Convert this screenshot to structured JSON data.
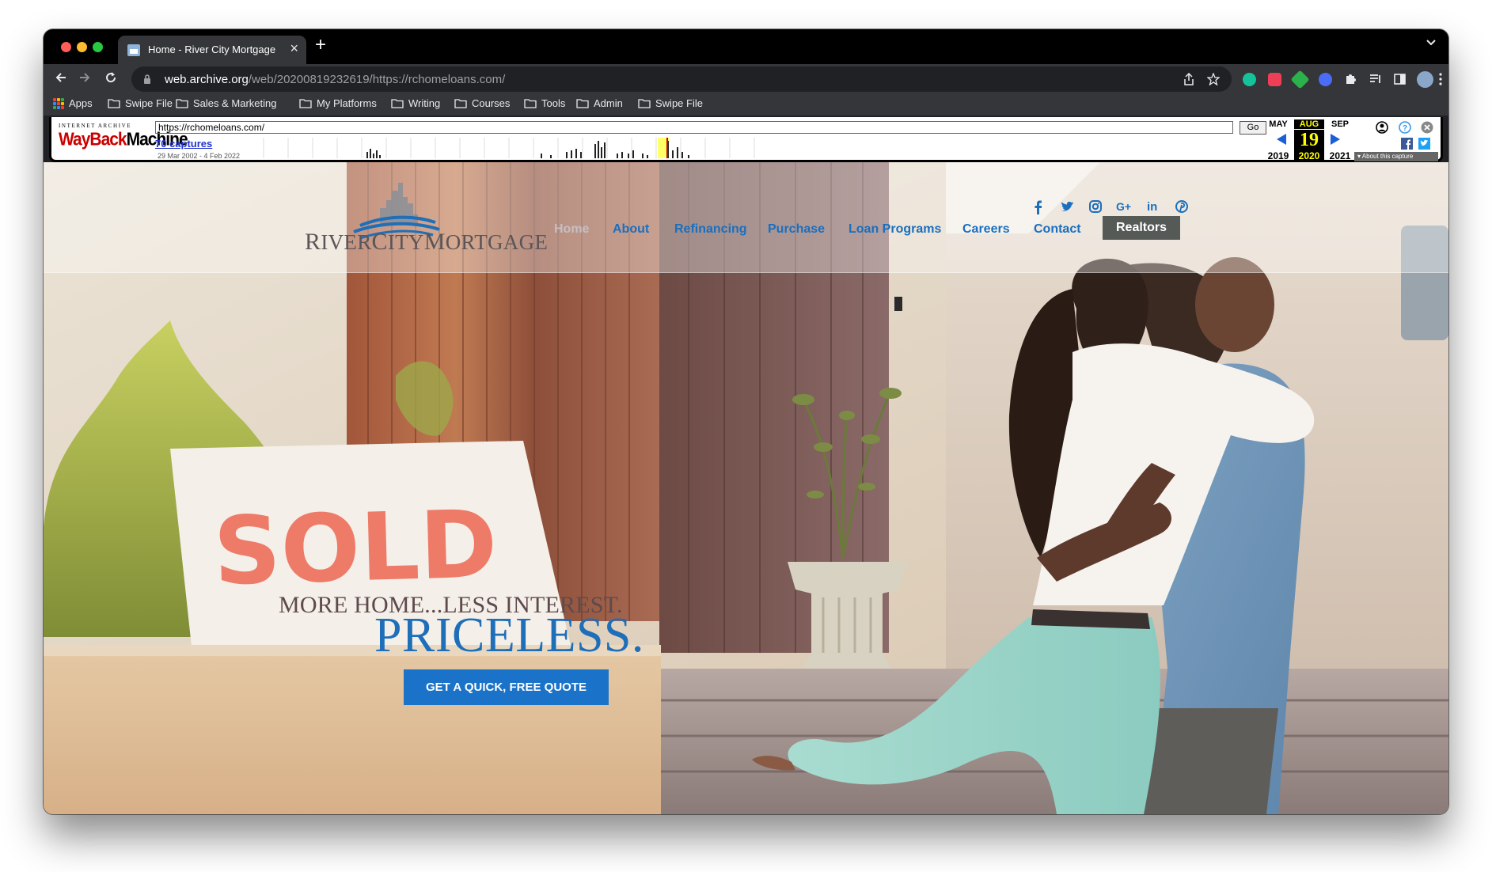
{
  "browser": {
    "tab": {
      "title": "Home - River City Mortgage"
    },
    "address": {
      "host": "web.archive.org",
      "path": "/web/20200819232619/https://rchomeloans.com/"
    },
    "bookmarks": [
      {
        "label": "Apps"
      },
      {
        "label": "Swipe File"
      },
      {
        "label": "Sales & Marketing"
      },
      {
        "label": "My Platforms"
      },
      {
        "label": "Writing"
      },
      {
        "label": "Courses"
      },
      {
        "label": "Tools"
      },
      {
        "label": "Admin"
      },
      {
        "label": "Swipe File"
      }
    ]
  },
  "wayback": {
    "logo_top": "INTERNET ARCHIVE",
    "logo_wayback": "WayBack",
    "logo_machine": "Machine",
    "url": "https://rchomeloans.com/",
    "go": "Go",
    "captures": "70 captures",
    "range": "29 Mar 2002 - 4 Feb 2022",
    "months": {
      "prev": "MAY",
      "current": "AUG",
      "next": "SEP"
    },
    "day": "19",
    "years": {
      "prev": "2019",
      "current": "2020",
      "next": "2021"
    },
    "about": "About this capture"
  },
  "site": {
    "logo": {
      "part1": "R",
      "part2": "IVER",
      "part3": "C",
      "part4": "ITY",
      "part5": "M",
      "part6": "ORTGAGE"
    },
    "nav": [
      "Home",
      "About",
      "Refinancing",
      "Purchase",
      "Loan Programs",
      "Careers",
      "Contact",
      "Realtors"
    ],
    "social": [
      "facebook",
      "twitter",
      "instagram",
      "google-plus",
      "linkedin",
      "pinterest"
    ],
    "sign": "SOLD",
    "hero": {
      "line1": "MORE HOME...LESS INTEREST.",
      "line2": "PRICELESS.",
      "cta": "GET A QUICK, FREE QUOTE"
    }
  },
  "colors": {
    "nav_link": "#1a6fbf",
    "cta": "#1a73c8",
    "realtors_bg": "#555a57",
    "headline_blue": "#1f6fb8"
  }
}
